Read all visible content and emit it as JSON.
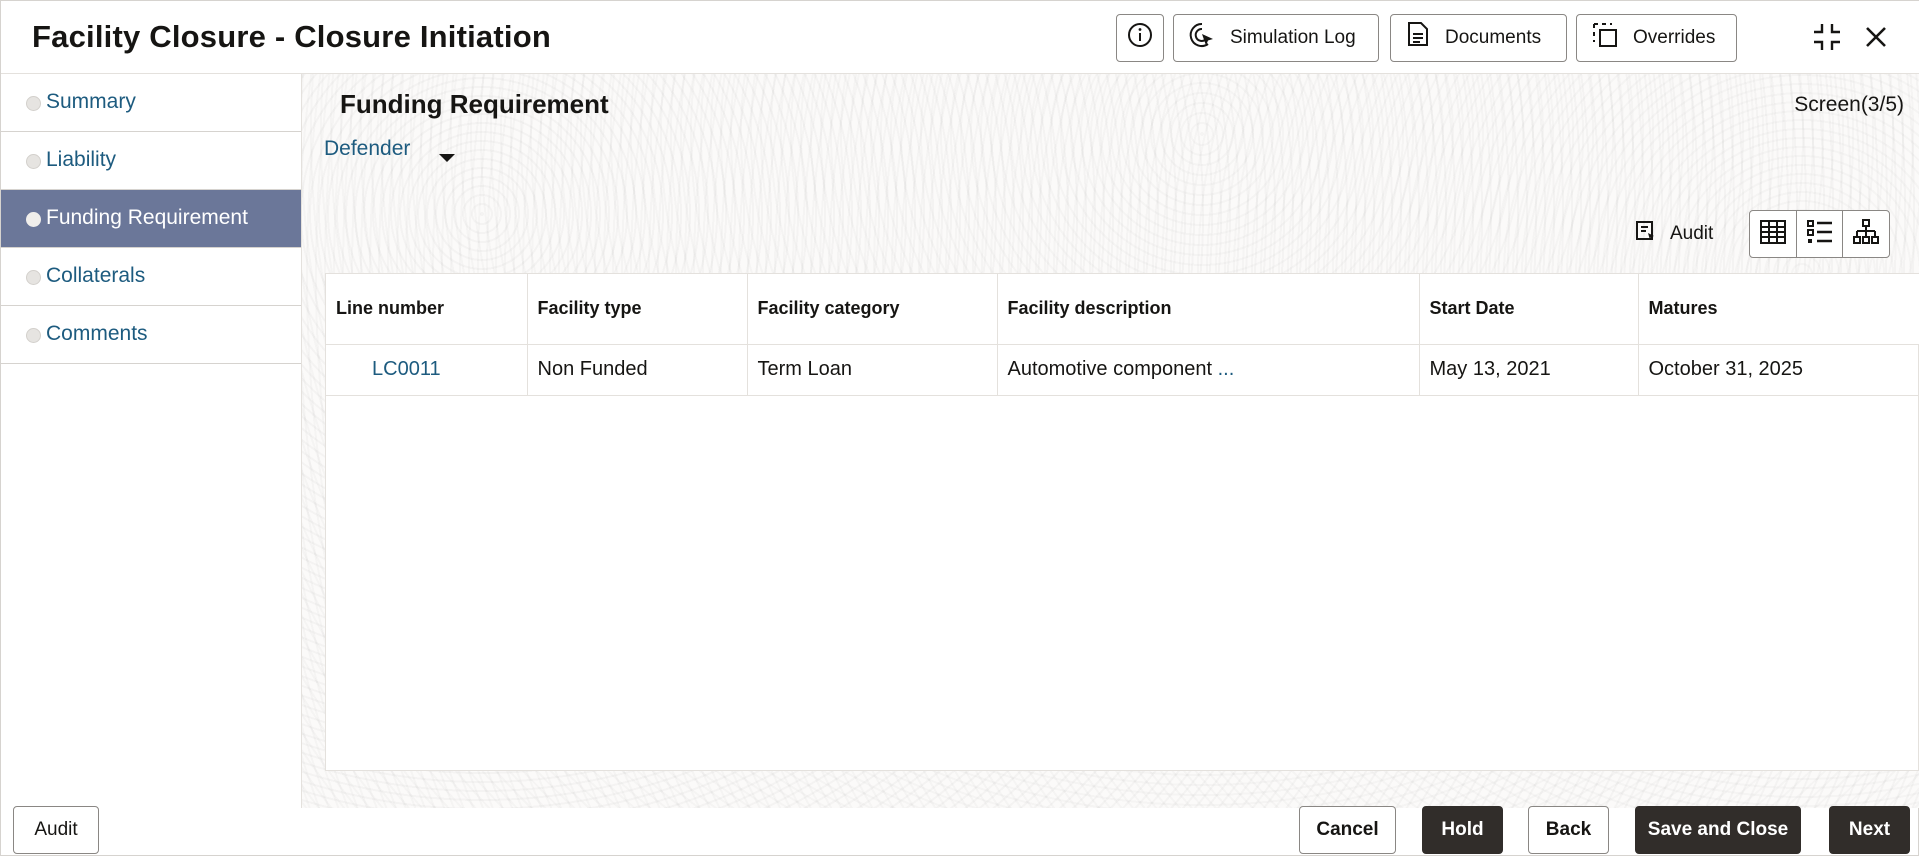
{
  "header": {
    "title": "Facility Closure - Closure Initiation",
    "buttons": {
      "info_icon": "info-icon",
      "simulation_log": "Simulation Log",
      "documents": "Documents",
      "overrides": "Overrides"
    }
  },
  "sidebar": {
    "items": [
      {
        "label": "Summary",
        "active": false
      },
      {
        "label": "Liability",
        "active": false
      },
      {
        "label": "Funding Requirement",
        "active": true
      },
      {
        "label": "Collaterals",
        "active": false
      },
      {
        "label": "Comments",
        "active": false
      }
    ]
  },
  "main": {
    "section_title": "Funding Requirement",
    "screen_counter": "Screen(3/5)",
    "party_selector": "Defender",
    "audit_label": "Audit",
    "table": {
      "columns": [
        "Line number",
        "Facility type",
        "Facility category",
        "Facility description",
        "Start Date",
        "Matures"
      ],
      "rows": [
        {
          "line_number": "LC0011",
          "facility_type": "Non Funded",
          "facility_category": "Term Loan",
          "facility_description": "Automotive component",
          "description_more": "...",
          "start_date": "May 13, 2021",
          "matures": "October 31, 2025"
        }
      ]
    }
  },
  "footer": {
    "audit": "Audit",
    "cancel": "Cancel",
    "hold": "Hold",
    "back": "Back",
    "save_and_close": "Save and Close",
    "next": "Next"
  },
  "colors": {
    "accent_nav": "#6b7799",
    "link": "#1d5b7f",
    "dark_button": "#312d2a"
  }
}
